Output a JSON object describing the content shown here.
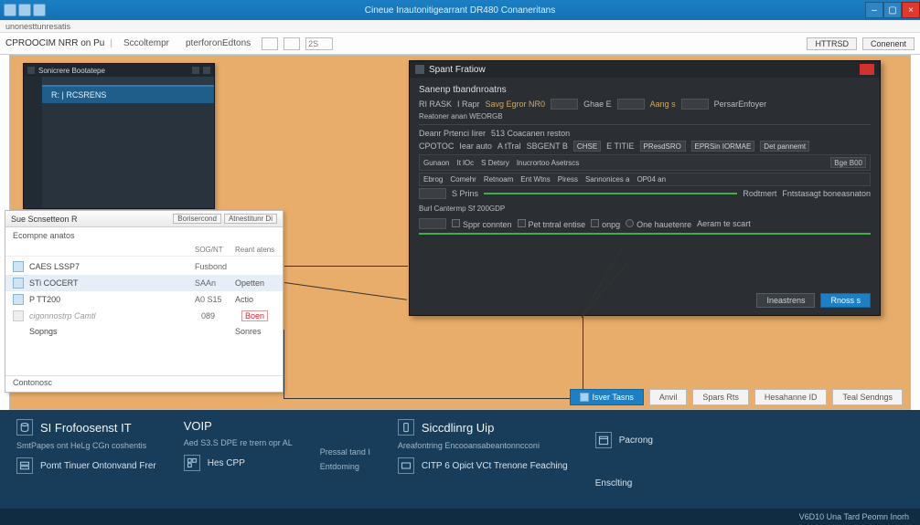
{
  "titlebar": {
    "title": "Cineue Inautonitigearrant DR480 Conaneritans",
    "subtitle": "unonesttunresatis"
  },
  "toolbar": {
    "crumb": "CPROOCIM NRR on Pu",
    "tab1": "Sccoltempr",
    "tab2": "pterforonEdtons",
    "search": "2S",
    "btn1": "HTTRSD",
    "btn2": "Conenent"
  },
  "ide": {
    "title": "Sonicrere Bootatepe",
    "active_row": "R: | RCSRENS"
  },
  "panel": {
    "title": "Sue Scnsetteon R",
    "btn1": "Borisercond",
    "btn2": "Atnestitunr Di",
    "subtitle": "Ecompne anatos",
    "col_a": "SOG/NT",
    "col_b": "Reant atens",
    "rows": [
      {
        "name": "CAES LSSP7",
        "c1": "Fusbond",
        "c2": ""
      },
      {
        "name": "STi COCERT",
        "c1": "SAAn",
        "c2": "Opetten"
      },
      {
        "name": "P TT200",
        "c1": "A0 S15",
        "c2": "Actio"
      },
      {
        "name": "cigonnostrp Camtl",
        "c1": "089",
        "c2": "Boen"
      }
    ],
    "sum_label": "Sopngs",
    "sum_val": "Sonres",
    "footer": "Contonosc"
  },
  "dlg": {
    "title": "Spant Fratiow",
    "section": "Sanenp tbandnroatns",
    "line1": [
      "RI RASK",
      "I Rapr",
      "Savg Egror NR0",
      "Ghae E",
      "Aang s",
      "PersarEnfoyer"
    ],
    "line1b": "Reatoner anan WEORGB",
    "line2": [
      "Deanr Prtenci Iirer",
      "513 Coacanen reston"
    ],
    "line3": [
      "CPOTOC",
      "Iear auto",
      "A tTral",
      "SBGENT B",
      "CHSE",
      "E TITIE",
      "PResdSRO",
      "EPRSin IORMAE",
      "Det pannemt"
    ],
    "line4": [
      "Gunaon",
      "It lOc",
      "S Detsry",
      "Inucrortoo Asetrscs",
      "Bge B00"
    ],
    "line5": [
      "Ebrog",
      "Comehr",
      "Retnoam",
      "Ent Wtns",
      "Piress",
      "Sannonices a",
      "OP04 an"
    ],
    "line6": "S Prins",
    "line6r": [
      "Rodtmert",
      "Fntstasagt boneasnaton"
    ],
    "line7": "Burl Cantermp Sf 200GDP",
    "checks": [
      "Sppr connten",
      "Pet tntral entise",
      "onpg",
      "One hauetenre",
      "Aeram te scart"
    ],
    "btn1": "Ineastrens",
    "btn2": "Rnoss s"
  },
  "actions": {
    "primary": "Isver Tasns",
    "b2": "Anvil",
    "b3": "Spars Rts",
    "b4": "Hesahanne ID",
    "b5": "Teal Sendngs"
  },
  "footer": {
    "c1_h": "SI Frofoosenst IT",
    "c1_s": "SmtPapes ont HeLg CGn coshentis",
    "c1_r": "Pomt Tinuer Ontonvand Frer",
    "c2_h": "VOIP",
    "c2_s": "Aed S3.S DPE re trern opr AL",
    "c2_r": "Hes CPP",
    "c3_l1": "Pressal tand I",
    "c3_l2": "Entdoming",
    "c4_h": "Siccdlinrg Uip",
    "c4_s": "Areafontring Encooansabeantonncconi",
    "c4_r": "CITP 6 Opict VCt Trenone Feaching",
    "c5_l1": "Pacrong",
    "c5_l2": "Ensclting"
  },
  "status": "V6D10 Una Tard Peomn Inorh"
}
